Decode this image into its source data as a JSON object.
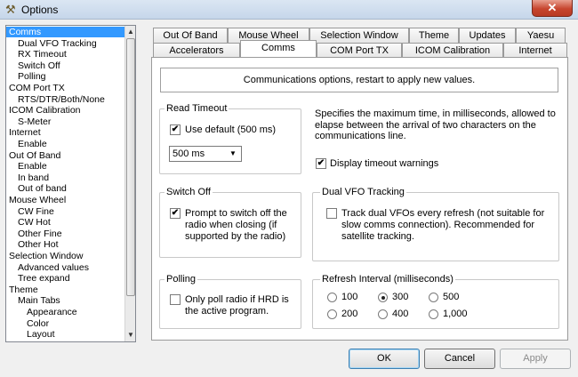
{
  "window": {
    "title": "Options",
    "close_glyph": "✕"
  },
  "tree": {
    "items": [
      {
        "label": "Comms",
        "indent": 0,
        "selected": true
      },
      {
        "label": "Dual VFO Tracking",
        "indent": 1
      },
      {
        "label": "RX Timeout",
        "indent": 1
      },
      {
        "label": "Switch Off",
        "indent": 1
      },
      {
        "label": "Polling",
        "indent": 1
      },
      {
        "label": "COM Port TX",
        "indent": 0
      },
      {
        "label": "RTS/DTR/Both/None",
        "indent": 1
      },
      {
        "label": "ICOM Calibration",
        "indent": 0
      },
      {
        "label": "S-Meter",
        "indent": 1
      },
      {
        "label": "Internet",
        "indent": 0
      },
      {
        "label": "Enable",
        "indent": 1
      },
      {
        "label": "Out Of Band",
        "indent": 0
      },
      {
        "label": "Enable",
        "indent": 1
      },
      {
        "label": "In band",
        "indent": 1
      },
      {
        "label": "Out of band",
        "indent": 1
      },
      {
        "label": "Mouse Wheel",
        "indent": 0
      },
      {
        "label": "CW Fine",
        "indent": 1
      },
      {
        "label": "CW Hot",
        "indent": 1
      },
      {
        "label": "Other Fine",
        "indent": 1
      },
      {
        "label": "Other Hot",
        "indent": 1
      },
      {
        "label": "Selection Window",
        "indent": 0
      },
      {
        "label": "Advanced values",
        "indent": 1
      },
      {
        "label": "Tree expand",
        "indent": 1
      },
      {
        "label": "Theme",
        "indent": 0
      },
      {
        "label": "Main Tabs",
        "indent": 1
      },
      {
        "label": "Appearance",
        "indent": 2
      },
      {
        "label": "Color",
        "indent": 2
      },
      {
        "label": "Layout",
        "indent": 2
      }
    ]
  },
  "tabs": {
    "row1": [
      "Out Of Band",
      "Mouse Wheel",
      "Selection Window",
      "Theme",
      "Updates",
      "Yaesu"
    ],
    "row2": [
      "Accelerators",
      "Comms",
      "COM Port TX",
      "ICOM Calibration",
      "Internet"
    ],
    "active": "Comms"
  },
  "comms": {
    "info": "Communications options, restart to apply new values.",
    "read_timeout": {
      "title": "Read Timeout",
      "use_default_label": "Use default (500 ms)",
      "use_default_checked": true,
      "select_value": "500 ms",
      "description": "Specifies the maximum time, in milliseconds, allowed to elapse between the arrival of two characters on the communications line.",
      "display_warnings_label": "Display timeout warnings",
      "display_warnings_checked": true
    },
    "switch_off": {
      "title": "Switch Off",
      "prompt_label": "Prompt to switch off the radio when closing (if supported by the radio)",
      "prompt_checked": true
    },
    "dual_vfo": {
      "title": "Dual VFO Tracking",
      "track_label": "Track dual VFOs every refresh (not suitable for slow comms connection). Recommended for satellite tracking.",
      "track_checked": false
    },
    "polling": {
      "title": "Polling",
      "only_poll_label": "Only poll radio if HRD is the active program.",
      "only_poll_checked": false
    },
    "refresh": {
      "title": "Refresh Interval (milliseconds)",
      "options": [
        "100",
        "300",
        "500",
        "200",
        "400",
        "1,000"
      ],
      "selected": "300"
    }
  },
  "buttons": {
    "ok": "OK",
    "cancel": "Cancel",
    "apply": "Apply"
  }
}
